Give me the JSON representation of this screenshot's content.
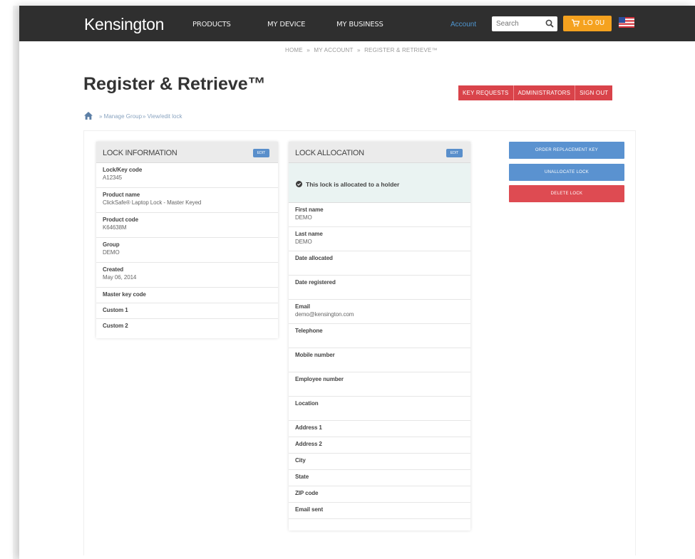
{
  "header": {
    "logo": "Kensington",
    "nav": [
      "PRODUCTS",
      "MY DEVICE",
      "MY BUSINESS"
    ],
    "account": "Account",
    "search_placeholder": "Search",
    "cart_label": "LO 0U",
    "accent_color": "#f5a21f"
  },
  "top_breadcrumb": [
    "HOME",
    "»",
    "MY ACCOUNT",
    "»",
    "REGISTER & RETRIEVE™"
  ],
  "page": {
    "title": "Register & Retrieve™",
    "actions": [
      "KEY REQUESTS",
      "ADMINISTRATORS",
      "SIGN OUT"
    ]
  },
  "breadcrumb": {
    "items": [
      "» Manage Group",
      "» View/edit lock"
    ]
  },
  "lock_info": {
    "title": "LOCK INFORMATION",
    "edit": "EDIT",
    "rows": [
      {
        "label": "Lock/Key code",
        "value": "A12345"
      },
      {
        "label": "Product name",
        "value": "ClickSafe® Laptop Lock - Master Keyed"
      },
      {
        "label": "Product code",
        "value": "K64638M"
      },
      {
        "label": "Group",
        "value": "DEMO"
      },
      {
        "label": "Created",
        "value": "May 06, 2014"
      },
      {
        "label": "Master key code",
        "value": ""
      },
      {
        "label": "Custom 1",
        "value": ""
      },
      {
        "label": "Custom 2",
        "value": ""
      }
    ]
  },
  "allocation": {
    "title": "LOCK ALLOCATION",
    "edit": "EDIT",
    "notice": "This lock is allocated to a holder",
    "rows": [
      {
        "label": "First name",
        "value": "DEMO"
      },
      {
        "label": "Last name",
        "value": "DEMO"
      },
      {
        "label": "Date allocated",
        "value": ""
      },
      {
        "label": "Date registered",
        "value": ""
      },
      {
        "label": "Email",
        "value": "demo@kensington.com"
      },
      {
        "label": "Telephone",
        "value": ""
      },
      {
        "label": "Mobile number",
        "value": ""
      },
      {
        "label": "Employee number",
        "value": ""
      },
      {
        "label": "Location",
        "value": ""
      },
      {
        "label": "Address 1",
        "value": ""
      },
      {
        "label": "Address 2",
        "value": ""
      },
      {
        "label": "City",
        "value": ""
      },
      {
        "label": "State",
        "value": ""
      },
      {
        "label": "ZIP code",
        "value": ""
      },
      {
        "label": "Email sent",
        "value": ""
      }
    ]
  },
  "side_actions": [
    "ORDER REPLACEMENT KEY",
    "UNALLOCATE LOCK",
    "DELETE LOCK"
  ]
}
